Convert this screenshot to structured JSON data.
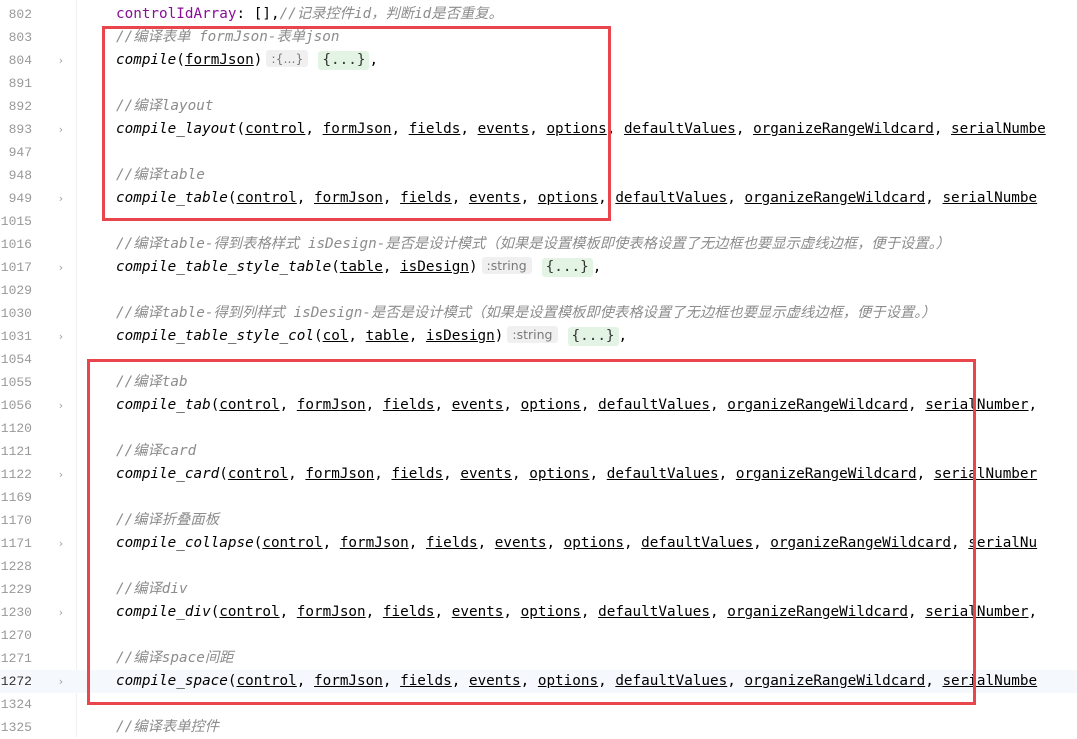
{
  "lines": [
    {
      "num": "802",
      "fold": false,
      "parts": [
        [
          "prop",
          "controlIdArray"
        ],
        [
          "pl",
          ": [],"
        ],
        [
          "cmt",
          "//记录控件id，判断id是否重复。"
        ]
      ]
    },
    {
      "num": "803",
      "fold": false,
      "parts": [
        [
          "cmt",
          "//编译表单 formJson-表单json"
        ]
      ]
    },
    {
      "num": "804",
      "fold": true,
      "parts": [
        [
          "fn",
          "compile"
        ],
        [
          "pl",
          "("
        ],
        [
          "p",
          "formJson"
        ],
        [
          "pl",
          ")"
        ],
        [
          "hint",
          ":{...}"
        ],
        [
          "fold",
          "{...}"
        ],
        [
          "pl",
          ","
        ]
      ]
    },
    {
      "num": "891",
      "fold": false,
      "parts": []
    },
    {
      "num": "892",
      "fold": false,
      "parts": [
        [
          "cmt",
          "//编译layout"
        ]
      ]
    },
    {
      "num": "893",
      "fold": true,
      "parts": [
        [
          "fn",
          "compile_layout"
        ],
        [
          "pl",
          "("
        ],
        [
          "p",
          "control"
        ],
        [
          "pl",
          ", "
        ],
        [
          "p",
          "formJson"
        ],
        [
          "pl",
          ", "
        ],
        [
          "p",
          "fields"
        ],
        [
          "pl",
          ", "
        ],
        [
          "p",
          "events"
        ],
        [
          "pl",
          ", "
        ],
        [
          "p",
          "options"
        ],
        [
          "pl",
          ", "
        ],
        [
          "p",
          "defaultValues"
        ],
        [
          "pl",
          ", "
        ],
        [
          "p",
          "organizeRangeWildcard"
        ],
        [
          "pl",
          ", "
        ],
        [
          "p",
          "serialNumbe"
        ]
      ]
    },
    {
      "num": "947",
      "fold": false,
      "parts": []
    },
    {
      "num": "948",
      "fold": false,
      "parts": [
        [
          "cmt",
          "//编译table"
        ]
      ]
    },
    {
      "num": "949",
      "fold": true,
      "parts": [
        [
          "fn",
          "compile_table"
        ],
        [
          "pl",
          "("
        ],
        [
          "p",
          "control"
        ],
        [
          "pl",
          ", "
        ],
        [
          "p",
          "formJson"
        ],
        [
          "pl",
          ", "
        ],
        [
          "p",
          "fields"
        ],
        [
          "pl",
          ", "
        ],
        [
          "p",
          "events"
        ],
        [
          "pl",
          ", "
        ],
        [
          "p",
          "options"
        ],
        [
          "pl",
          ", "
        ],
        [
          "p",
          "defaultValues"
        ],
        [
          "pl",
          ", "
        ],
        [
          "p",
          "organizeRangeWildcard"
        ],
        [
          "pl",
          ", "
        ],
        [
          "p",
          "serialNumbe"
        ]
      ]
    },
    {
      "num": "1015",
      "fold": false,
      "parts": []
    },
    {
      "num": "1016",
      "fold": false,
      "parts": [
        [
          "cmt",
          "//编译table-得到表格样式 isDesign-是否是设计模式（如果是设置模板即使表格设置了无边框也要显示虚线边框，便于设置。）"
        ]
      ]
    },
    {
      "num": "1017",
      "fold": true,
      "parts": [
        [
          "fn",
          "compile_table_style_table"
        ],
        [
          "pl",
          "("
        ],
        [
          "p",
          "table"
        ],
        [
          "pl",
          ", "
        ],
        [
          "p",
          "isDesign"
        ],
        [
          "pl",
          ")"
        ],
        [
          "hint",
          ":string"
        ],
        [
          "fold",
          "{...}"
        ],
        [
          "pl",
          ","
        ]
      ]
    },
    {
      "num": "1029",
      "fold": false,
      "parts": []
    },
    {
      "num": "1030",
      "fold": false,
      "parts": [
        [
          "cmt",
          "//编译table-得到列样式 isDesign-是否是设计模式（如果是设置模板即使表格设置了无边框也要显示虚线边框，便于设置。）"
        ]
      ]
    },
    {
      "num": "1031",
      "fold": true,
      "parts": [
        [
          "fn",
          "compile_table_style_col"
        ],
        [
          "pl",
          "("
        ],
        [
          "p",
          "col"
        ],
        [
          "pl",
          ", "
        ],
        [
          "p",
          "table"
        ],
        [
          "pl",
          ", "
        ],
        [
          "p",
          "isDesign"
        ],
        [
          "pl",
          ")"
        ],
        [
          "hint",
          ":string"
        ],
        [
          "fold",
          "{...}"
        ],
        [
          "pl",
          ","
        ]
      ]
    },
    {
      "num": "1054",
      "fold": false,
      "parts": []
    },
    {
      "num": "1055",
      "fold": false,
      "parts": [
        [
          "cmt",
          "//编译tab"
        ]
      ]
    },
    {
      "num": "1056",
      "fold": true,
      "parts": [
        [
          "fn",
          "compile_tab"
        ],
        [
          "pl",
          "("
        ],
        [
          "p",
          "control"
        ],
        [
          "pl",
          ", "
        ],
        [
          "p",
          "formJson"
        ],
        [
          "pl",
          ", "
        ],
        [
          "p",
          "fields"
        ],
        [
          "pl",
          ", "
        ],
        [
          "p",
          "events"
        ],
        [
          "pl",
          ", "
        ],
        [
          "p",
          "options"
        ],
        [
          "pl",
          ", "
        ],
        [
          "p",
          "defaultValues"
        ],
        [
          "pl",
          ", "
        ],
        [
          "p",
          "organizeRangeWildcard"
        ],
        [
          "pl",
          ", "
        ],
        [
          "p",
          "serialNumber"
        ],
        [
          "pl",
          ","
        ]
      ]
    },
    {
      "num": "1120",
      "fold": false,
      "parts": []
    },
    {
      "num": "1121",
      "fold": false,
      "parts": [
        [
          "cmt",
          "//编译card"
        ]
      ]
    },
    {
      "num": "1122",
      "fold": true,
      "parts": [
        [
          "fn",
          "compile_card"
        ],
        [
          "pl",
          "("
        ],
        [
          "p",
          "control"
        ],
        [
          "pl",
          ", "
        ],
        [
          "p",
          "formJson"
        ],
        [
          "pl",
          ", "
        ],
        [
          "p",
          "fields"
        ],
        [
          "pl",
          ", "
        ],
        [
          "p",
          "events"
        ],
        [
          "pl",
          ", "
        ],
        [
          "p",
          "options"
        ],
        [
          "pl",
          ", "
        ],
        [
          "p",
          "defaultValues"
        ],
        [
          "pl",
          ", "
        ],
        [
          "p",
          "organizeRangeWildcard"
        ],
        [
          "pl",
          ", "
        ],
        [
          "p",
          "serialNumber"
        ]
      ]
    },
    {
      "num": "1169",
      "fold": false,
      "parts": []
    },
    {
      "num": "1170",
      "fold": false,
      "parts": [
        [
          "cmt",
          "//编译折叠面板"
        ]
      ]
    },
    {
      "num": "1171",
      "fold": true,
      "parts": [
        [
          "fn",
          "compile_collapse"
        ],
        [
          "pl",
          "("
        ],
        [
          "p",
          "control"
        ],
        [
          "pl",
          ", "
        ],
        [
          "p",
          "formJson"
        ],
        [
          "pl",
          ", "
        ],
        [
          "p",
          "fields"
        ],
        [
          "pl",
          ", "
        ],
        [
          "p",
          "events"
        ],
        [
          "pl",
          ", "
        ],
        [
          "p",
          "options"
        ],
        [
          "pl",
          ", "
        ],
        [
          "p",
          "defaultValues"
        ],
        [
          "pl",
          ", "
        ],
        [
          "p",
          "organizeRangeWildcard"
        ],
        [
          "pl",
          ", "
        ],
        [
          "p",
          "serialNu"
        ]
      ]
    },
    {
      "num": "1228",
      "fold": false,
      "parts": []
    },
    {
      "num": "1229",
      "fold": false,
      "parts": [
        [
          "cmt",
          "//编译div"
        ]
      ]
    },
    {
      "num": "1230",
      "fold": true,
      "parts": [
        [
          "fn",
          "compile_div"
        ],
        [
          "pl",
          "("
        ],
        [
          "p",
          "control"
        ],
        [
          "pl",
          ", "
        ],
        [
          "p",
          "formJson"
        ],
        [
          "pl",
          ", "
        ],
        [
          "p",
          "fields"
        ],
        [
          "pl",
          ", "
        ],
        [
          "p",
          "events"
        ],
        [
          "pl",
          ", "
        ],
        [
          "p",
          "options"
        ],
        [
          "pl",
          ", "
        ],
        [
          "p",
          "defaultValues"
        ],
        [
          "pl",
          ", "
        ],
        [
          "p",
          "organizeRangeWildcard"
        ],
        [
          "pl",
          ", "
        ],
        [
          "p",
          "serialNumber"
        ],
        [
          "pl",
          ","
        ]
      ]
    },
    {
      "num": "1270",
      "fold": false,
      "parts": []
    },
    {
      "num": "1271",
      "fold": false,
      "parts": [
        [
          "cmt",
          "//编译space间距"
        ]
      ]
    },
    {
      "num": "1272",
      "fold": true,
      "active": true,
      "parts": [
        [
          "fn",
          "compile_space"
        ],
        [
          "pl",
          "("
        ],
        [
          "p",
          "control"
        ],
        [
          "pl",
          ", "
        ],
        [
          "p",
          "formJson"
        ],
        [
          "pl",
          ", "
        ],
        [
          "p",
          "fields"
        ],
        [
          "pl",
          ", "
        ],
        [
          "p",
          "events"
        ],
        [
          "pl",
          ", "
        ],
        [
          "p",
          "options"
        ],
        [
          "pl",
          ", "
        ],
        [
          "p",
          "defaultValues"
        ],
        [
          "pl",
          ", "
        ],
        [
          "p",
          "organizeRangeWildcard"
        ],
        [
          "pl",
          ", "
        ],
        [
          "p",
          "serialNumbe"
        ]
      ]
    },
    {
      "num": "1324",
      "fold": false,
      "parts": []
    },
    {
      "num": "1325",
      "fold": false,
      "parts": [
        [
          "cmt",
          "//编译表单控件"
        ]
      ]
    }
  ],
  "fold_icon": "chevron-right-icon",
  "highlight_color": "#e8454d"
}
